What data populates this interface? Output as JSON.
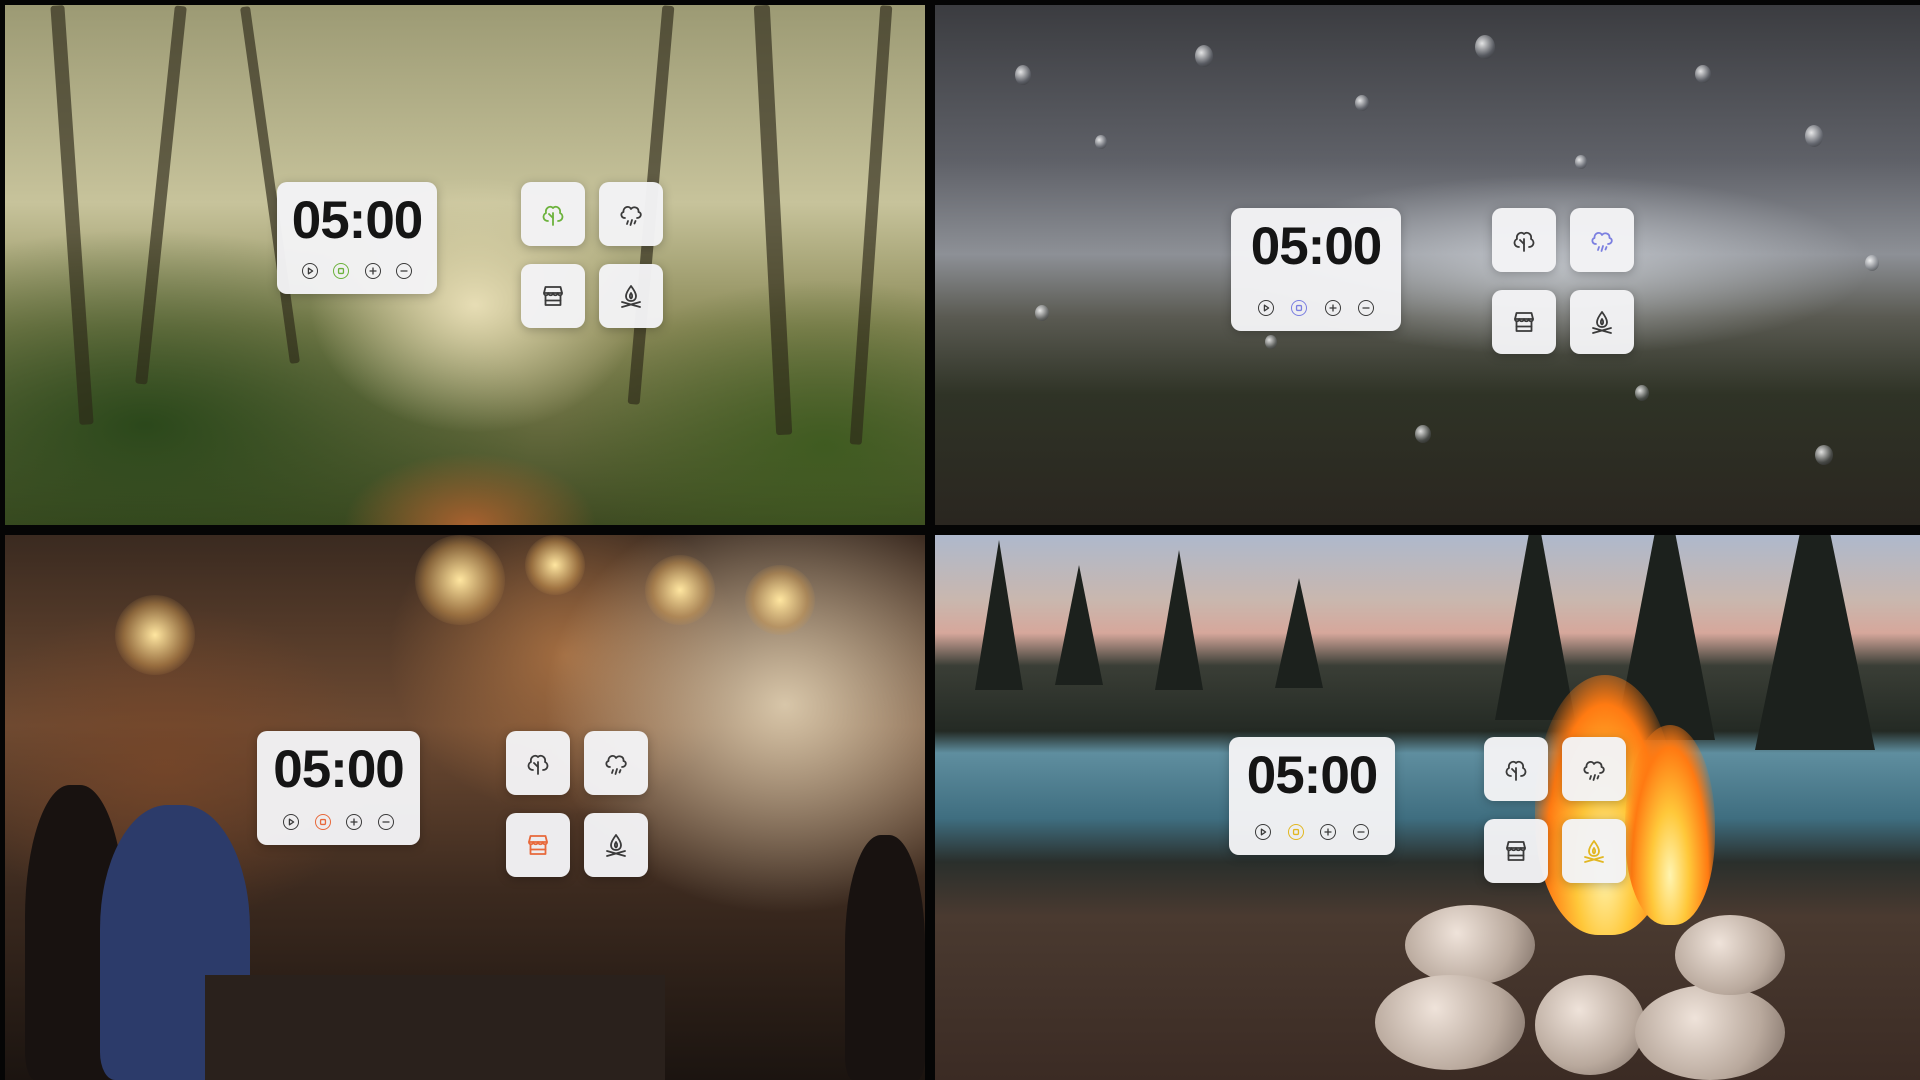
{
  "panels": [
    {
      "name": "forest",
      "time": "05:00",
      "accent": "#6cb23c",
      "active_sound": "forest"
    },
    {
      "name": "rain",
      "time": "05:00",
      "accent": "#7b7fe0",
      "active_sound": "rain"
    },
    {
      "name": "cafe",
      "time": "05:00",
      "accent": "#e8683a",
      "active_sound": "cafe"
    },
    {
      "name": "campfire",
      "time": "05:00",
      "accent": "#e2b722",
      "active_sound": "campfire"
    }
  ],
  "controls": [
    "play-icon",
    "stop-icon",
    "plus-icon",
    "minus-icon"
  ],
  "sounds": [
    "forest-icon",
    "rain-cloud-icon",
    "cafe-store-icon",
    "campfire-icon"
  ],
  "default_icon_color": "#3a3a3a"
}
